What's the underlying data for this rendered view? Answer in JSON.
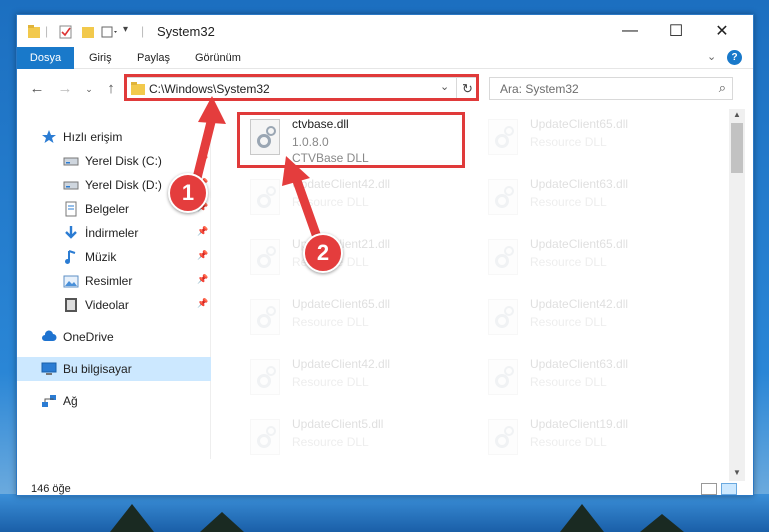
{
  "window": {
    "title": "System32",
    "ribbon_tabs": [
      "Dosya",
      "Giriş",
      "Paylaş",
      "Görünüm"
    ]
  },
  "address": {
    "path": "C:\\Windows\\System32"
  },
  "search": {
    "placeholder": "Ara: System32"
  },
  "sidebar": {
    "items": [
      {
        "label": "Hızlı erişim",
        "icon": "star-icon"
      },
      {
        "label": "Yerel Disk (C:)",
        "icon": "drive-icon",
        "pinned": true
      },
      {
        "label": "Yerel Disk (D:)",
        "icon": "drive-icon",
        "pinned": true
      },
      {
        "label": "Belgeler",
        "icon": "documents-icon",
        "pinned": true
      },
      {
        "label": "İndirmeler",
        "icon": "download-icon",
        "pinned": true
      },
      {
        "label": "Müzik",
        "icon": "music-icon",
        "pinned": true
      },
      {
        "label": "Resimler",
        "icon": "pictures-icon",
        "pinned": true
      },
      {
        "label": "Videolar",
        "icon": "videos-icon",
        "pinned": true
      },
      {
        "label": "OneDrive",
        "icon": "cloud-icon"
      },
      {
        "label": "Bu bilgisayar",
        "icon": "computer-icon",
        "selected": true
      },
      {
        "label": "Ağ",
        "icon": "network-icon"
      }
    ]
  },
  "files": [
    {
      "name": "ctvbase.dll",
      "version": "1.0.8.0",
      "desc": "CTVBase DLL",
      "highlighted": true
    },
    {
      "name": "UpdateClient65.dll",
      "desc": "Resource DLL"
    },
    {
      "name": "UpdateClient42.dll",
      "desc": "Resource DLL"
    },
    {
      "name": "UpdateClient63.dll",
      "desc": "Resource DLL"
    },
    {
      "name": "UpdateClient21.dll",
      "desc": "Resource DLL"
    },
    {
      "name": "UpdateClient65.dll",
      "desc": "Resource DLL"
    },
    {
      "name": "UpdateClient65.dll",
      "desc": "Resource DLL"
    },
    {
      "name": "UpdateClient42.dll",
      "desc": "Resource DLL"
    },
    {
      "name": "UpdateClient42.dll",
      "desc": "Resource DLL"
    },
    {
      "name": "UpdateClient63.dll",
      "desc": "Resource DLL"
    },
    {
      "name": "UpdateClient5.dll",
      "desc": "Resource DLL"
    },
    {
      "name": "UpdateClient19.dll",
      "desc": "Resource DLL"
    }
  ],
  "status": {
    "count": "146 öğe"
  },
  "annotations": {
    "step1": "1",
    "step2": "2"
  },
  "colors": {
    "accent": "#1979ca",
    "annotation": "#e43d3d",
    "selection": "#cce8ff"
  }
}
